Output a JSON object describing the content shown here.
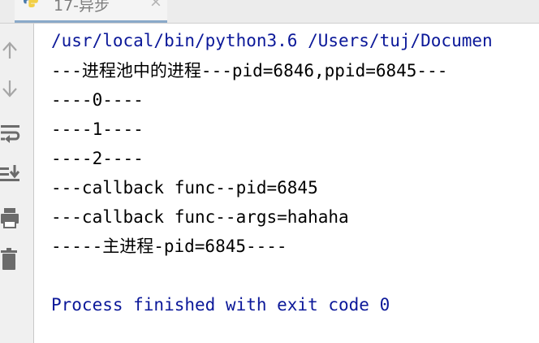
{
  "run_tab": {
    "title": "17-异步",
    "close_glyph": "×",
    "icon": "python-icon"
  },
  "toolbar": {
    "icons": [
      "arrow-up-icon",
      "arrow-down-icon",
      "soft-wrap-icon",
      "scroll-to-end-icon",
      "print-icon",
      "trash-icon"
    ]
  },
  "console": {
    "command": "/usr/local/bin/python3.6 /Users/tuj/Documen",
    "lines": [
      "---进程池中的进程---pid=6846,ppid=6845---",
      "----0----",
      "----1----",
      "----2----",
      "---callback func--pid=6845",
      "---callback func--args=hahaha",
      "-----主进程-pid=6845----",
      ""
    ],
    "exit_message": "Process finished with exit code 0"
  },
  "colors": {
    "system_text": "#0b1899",
    "output_text": "#000000",
    "gutter_bg": "#f0f0f0",
    "tab_underline": "#8aa9c9"
  }
}
